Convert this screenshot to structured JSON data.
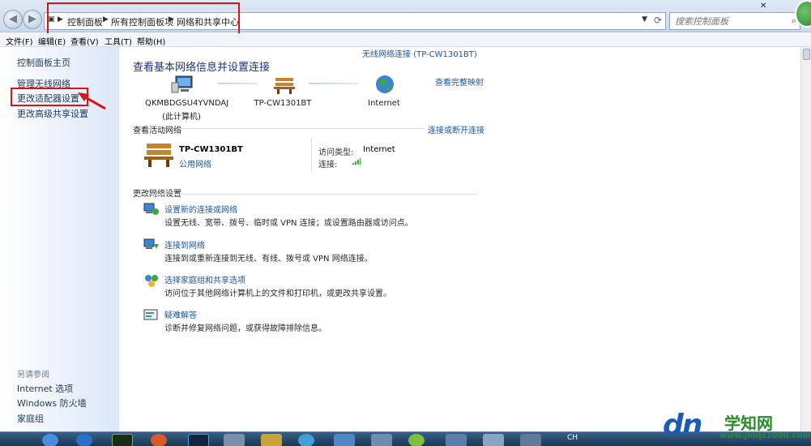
{
  "breadcrumb": {
    "items": [
      "控制面板",
      "所有控制面板项",
      "网络和共享中心"
    ]
  },
  "search": {
    "placeholder": "搜索控制面板"
  },
  "menu": [
    "文件(F)",
    "编辑(E)",
    "查看(V)",
    "工具(T)",
    "帮助(H)"
  ],
  "sidebar": {
    "links": [
      "控制面板主页",
      "管理无线网络",
      "更改适配器设置",
      "更改高级共享设置"
    ],
    "see_also_title": "另请参阅",
    "see_also": [
      "Internet 选项",
      "Windows 防火墙",
      "家庭组"
    ]
  },
  "main": {
    "title": "查看基本网络信息并设置连接",
    "full_map": "查看完整映射",
    "nodes": [
      {
        "name": "QKMBDGSU4YVNDAJ",
        "sub": "(此计算机)",
        "icon": "computer-icon"
      },
      {
        "name": "TP-CW1301BT",
        "sub": "",
        "icon": "bench-network-icon"
      },
      {
        "name": "Internet",
        "sub": "",
        "icon": "globe-icon"
      }
    ],
    "active_header": "查看活动网络",
    "connect_link": "连接或断开连接",
    "active_network": {
      "name": "TP-CW1301BT",
      "type": "公用网络",
      "access_label": "访问类型:",
      "access_value": "Internet",
      "conn_label": "连接:",
      "conn_value": "无线网络连接 (TP-CW1301BT)"
    },
    "change_header": "更改网络设置",
    "tasks": [
      {
        "title": "设置新的连接或网络",
        "desc": "设置无线、宽带、拨号、临时或 VPN 连接；或设置路由器或访问点。",
        "icon": "new-connection-icon"
      },
      {
        "title": "连接到网络",
        "desc": "连接到或重新连接到无线、有线、拨号或 VPN 网络连接。",
        "icon": "connect-network-icon"
      },
      {
        "title": "选择家庭组和共享选项",
        "desc": "访问位于其他网络计算机上的文件和打印机，或更改共享设置。",
        "icon": "homegroup-icon"
      },
      {
        "title": "疑难解答",
        "desc": "诊断并修复网络问题，或获得故障排除信息。",
        "icon": "troubleshoot-icon"
      }
    ]
  },
  "taskbar": {
    "clock": "CH"
  },
  "watermark": {
    "logo": "dn",
    "cn": "学知网",
    "url": "www.jmqz1000.com"
  },
  "colors": {
    "link": "#1a55a6",
    "title": "#1e3287",
    "highlight": "#d6141c",
    "taskbar": "#173955"
  }
}
